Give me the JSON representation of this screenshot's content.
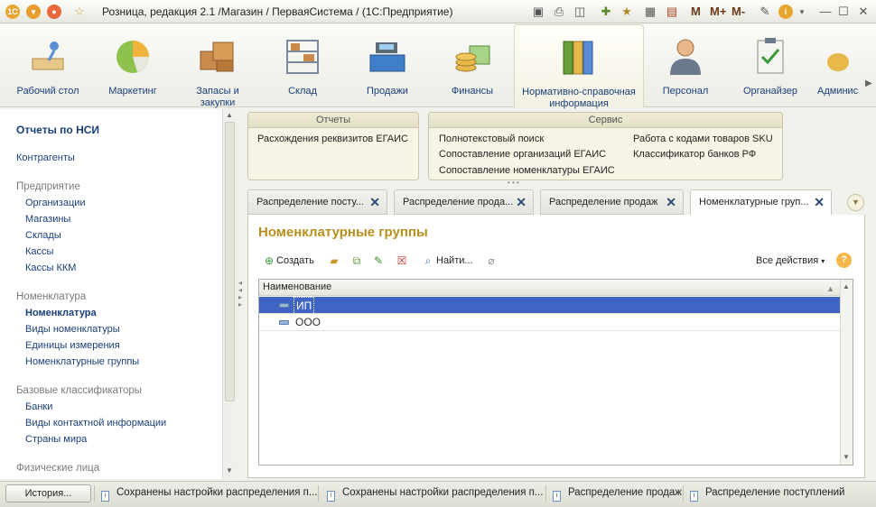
{
  "window": {
    "title": "Розница, редакция 2.1 /Магазин / ПерваяСистема /  (1С:Предприятие)",
    "toolbar_labels": [
      "M",
      "M+",
      "M-"
    ]
  },
  "sections": [
    {
      "label": "Рабочий стол",
      "icon": "desk-icon"
    },
    {
      "label": "Маркетинг",
      "icon": "pie-chart-icon"
    },
    {
      "label": "Запасы и закупки",
      "icon": "boxes-icon"
    },
    {
      "label": "Склад",
      "icon": "warehouse-shelves-icon"
    },
    {
      "label": "Продажи",
      "icon": "cash-register-icon"
    },
    {
      "label": "Финансы",
      "icon": "coins-icon"
    },
    {
      "label": "Нормативно-справочная информация",
      "icon": "binders-icon"
    },
    {
      "label": "Персонал",
      "icon": "person-icon"
    },
    {
      "label": "Органайзер",
      "icon": "clipboard-icon"
    },
    {
      "label": "Админис",
      "icon": "admin-icon"
    }
  ],
  "sidebar": {
    "title": "Отчеты по НСИ",
    "items": [
      {
        "label": "Контрагенты"
      },
      {
        "label": "Предприятие"
      },
      {
        "label": "Организации"
      },
      {
        "label": "Магазины"
      },
      {
        "label": "Склады"
      },
      {
        "label": "Кассы"
      },
      {
        "label": "Кассы ККМ"
      },
      {
        "label": "Номенклатура"
      },
      {
        "label": "Номенклатура"
      },
      {
        "label": "Виды номенклатуры"
      },
      {
        "label": "Единицы измерения"
      },
      {
        "label": "Номенклатурные группы"
      },
      {
        "label": "Базовые классификаторы"
      },
      {
        "label": "Банки"
      },
      {
        "label": "Виды контактной информации"
      },
      {
        "label": "Страны мира"
      },
      {
        "label": "Физические лица"
      }
    ]
  },
  "panels": {
    "reports": {
      "title": "Отчеты",
      "links": [
        "Расхождения реквизитов ЕГАИС"
      ]
    },
    "service": {
      "title": "Сервис",
      "links": [
        "Полнотекстовый поиск",
        "Сопоставление организаций ЕГАИС",
        "Сопоставление номенклатуры ЕГАИС",
        "Работа с кодами товаров SKU",
        "Классификатор банков РФ"
      ]
    }
  },
  "tabs": [
    {
      "label": "Распределение посту..."
    },
    {
      "label": "Распределение прода..."
    },
    {
      "label": "Распределение продаж"
    },
    {
      "label": "Номенклатурные груп..."
    }
  ],
  "form": {
    "title": "Номенклатурные группы",
    "toolbar": {
      "create": "Создать",
      "find": "Найти...",
      "all_actions": "Все действия"
    },
    "grid": {
      "column": "Наименование",
      "rows": [
        "ИП",
        "ООО"
      ]
    }
  },
  "statusbar": {
    "history": "История...",
    "items": [
      "Сохранены настройки распределения п...",
      "Сохранены настройки распределения п...",
      "Распределение продаж",
      "Распределение поступлений"
    ]
  }
}
